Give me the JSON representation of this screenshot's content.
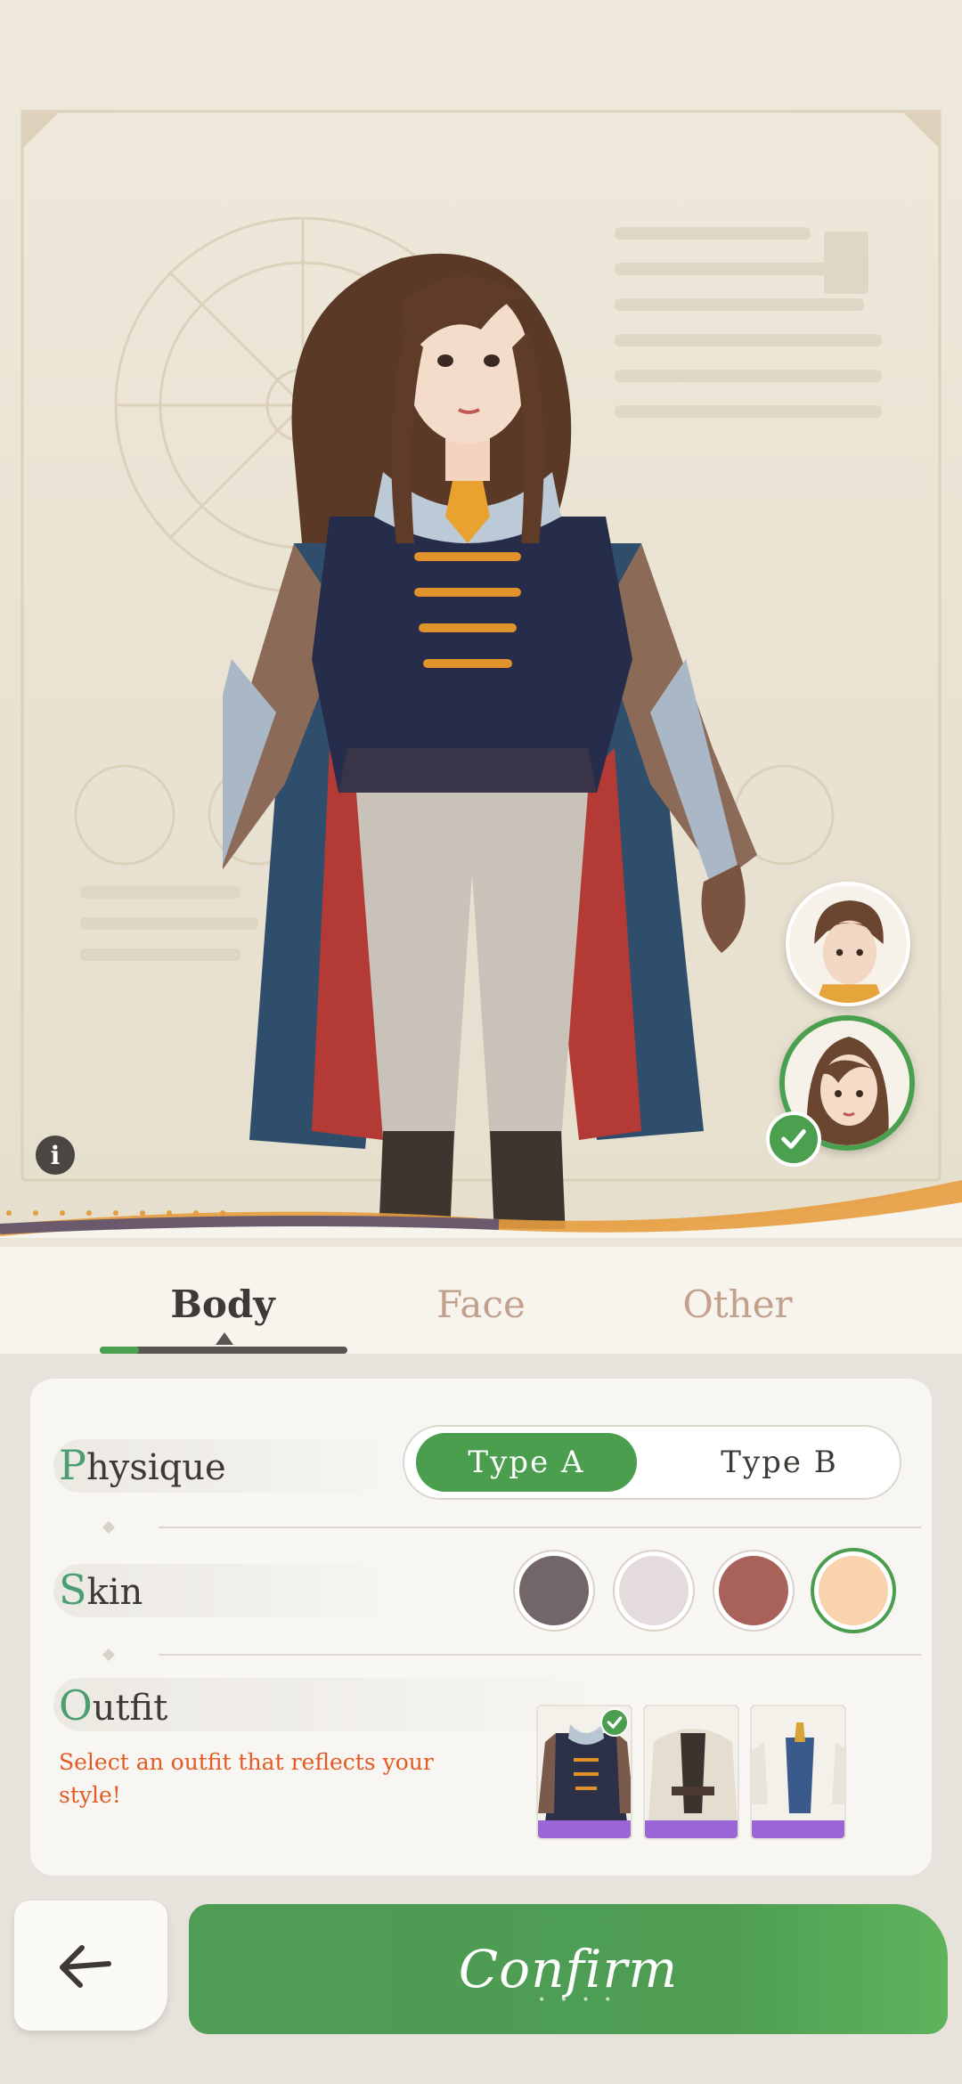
{
  "tabs": [
    {
      "label": "Body",
      "active": true
    },
    {
      "label": "Face",
      "active": false
    },
    {
      "label": "Other",
      "active": false
    }
  ],
  "physique": {
    "label_first": "P",
    "label_rest": "hysique",
    "options": [
      "Type A",
      "Type B"
    ],
    "selected": "Type A"
  },
  "skin": {
    "label_first": "S",
    "label_rest": "kin",
    "colors": [
      "#726669",
      "#e4dcdc",
      "#a9625a",
      "#f9d3ad"
    ],
    "selected_index": 3
  },
  "outfit": {
    "label_first": "O",
    "label_rest": "utfit",
    "hint": "Select an outfit that reflects your style!",
    "items": [
      "dark-blue-doublet",
      "cream-cloak",
      "white-blue-coat"
    ],
    "selected_index": 0
  },
  "portraits": [
    "portrait-short-hair",
    "portrait-long-hair"
  ],
  "selected_portrait": 1,
  "buttons": {
    "confirm": "Confirm",
    "back_icon": "arrow-left-icon",
    "info": "i"
  },
  "colors": {
    "accent_green": "#4a9e4e",
    "hint_orange": "#e35a22",
    "inactive_tab": "#c2a08c"
  }
}
